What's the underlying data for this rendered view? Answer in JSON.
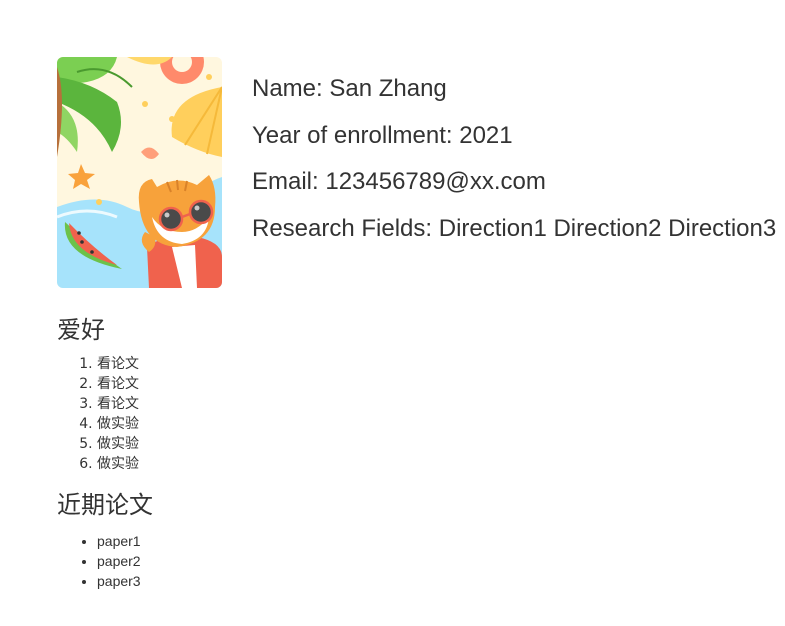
{
  "profile": {
    "avatar_icon": "cat-beach-illustration",
    "name_line": "Name: San Zhang",
    "year_line": "Year of enrollment: 2021",
    "email_line": "Email: 123456789@xx.com",
    "fields_line": "Research Fields: Direction1 Direction2 Direction3"
  },
  "hobbies": {
    "title": "爱好",
    "items": [
      "看论文",
      "看论文",
      "看论文",
      "做实验",
      "做实验",
      "做实验"
    ]
  },
  "papers": {
    "title": "近期论文",
    "items": [
      "paper1",
      "paper2",
      "paper3"
    ]
  },
  "colors": {
    "text": "#333333",
    "sky": "#a6e3fb",
    "sand": "#fff7df",
    "palm_green": "#6cc24a",
    "cat_orange": "#f7a23b",
    "shirt_red": "#f0624d"
  }
}
